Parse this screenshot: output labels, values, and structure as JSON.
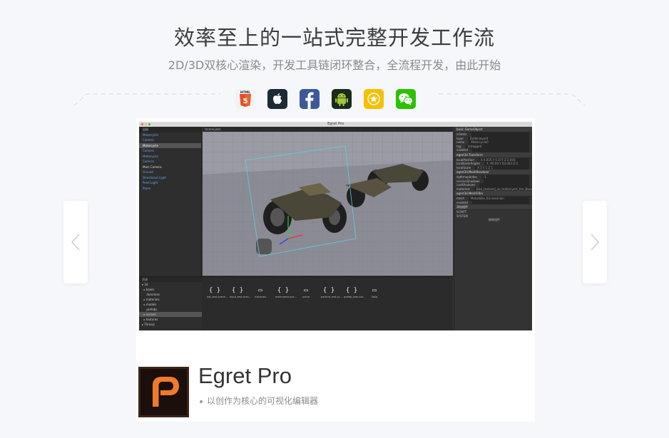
{
  "header": {
    "title": "效率至上的一站式完整开发工作流",
    "subtitle": "2D/3D双核心渲染，开发工具链闭环整合，全流程开发，由此开始"
  },
  "platforms": [
    {
      "icon": "html5-icon",
      "color": "#e34f26",
      "label": "HTML"
    },
    {
      "icon": "apple-icon",
      "color": "#1b2a34"
    },
    {
      "icon": "facebook-icon",
      "color": "#3b5998"
    },
    {
      "icon": "android-icon",
      "color": "#1b2a1b"
    },
    {
      "icon": "star-icon",
      "color": "#f5c000"
    },
    {
      "icon": "wechat-icon",
      "color": "#2dc100"
    }
  ],
  "editor": {
    "window_title": "Egret Pro",
    "tab": "/scene.json",
    "hierarchy_header": "层级",
    "hierarchy": [
      {
        "label": "Motorcycle",
        "style": "link"
      },
      {
        "label": "Camera",
        "style": "link"
      },
      {
        "label": "Motorcycle",
        "style": "selected"
      },
      {
        "label": "Camera",
        "style": "link"
      },
      {
        "label": "Motorcycle",
        "style": "link"
      },
      {
        "label": "Camera",
        "style": "link"
      },
      {
        "label": "Main Camera",
        "style": "white"
      },
      {
        "label": "Ground",
        "style": "link"
      },
      {
        "label": "Directional Light",
        "style": "link"
      },
      {
        "label": "Point Light",
        "style": "link"
      },
      {
        "label": "Plane",
        "style": "link"
      }
    ],
    "inspector": {
      "sections": [
        "basic GameObject",
        "egret3d.Transform",
        "egret3d.MeshRenderer",
        "egret3d.MeshFilter"
      ],
      "basic": [
        {
          "k": "isStatic",
          "v": ""
        },
        {
          "k": "layer",
          "v": "Builtinlayer0"
        },
        {
          "k": "name",
          "v": "Motorcycle0"
        },
        {
          "k": "tag",
          "v": "Untagged"
        },
        {
          "k": "enabled",
          "v": ""
        }
      ],
      "transform": [
        {
          "k": "localPosition",
          "v": "X 0.035  Y 0.377  Z 2.003"
        },
        {
          "k": "localEulerAngles",
          "v": "X -90.00  Y 63.003  Z 0"
        },
        {
          "k": "localScale",
          "v": "X 1  Y 1  Z 1"
        }
      ],
      "renderer": [
        {
          "k": "lightmapIndex",
          "v": "-1"
        },
        {
          "k": "receiveShadows",
          "v": ""
        },
        {
          "k": "castShadows",
          "v": ""
        },
        {
          "k": "materials",
          "v": "bike_texture/j_se_motorcycle_tire_BaseColor.mat"
        }
      ],
      "filter": [
        {
          "k": "mesh",
          "v": "Motorbike_03.mesh.bin"
        },
        {
          "k": "enabled",
          "v": ""
        }
      ],
      "add_component": "添加组件",
      "script": "SCRIPT",
      "system": "SYSTEM",
      "remove": "移除组件"
    },
    "project_header": "资源",
    "project": [
      {
        "label": "▾ 3d",
        "sel": false
      },
      {
        "label": "  ▸ bowls",
        "sel": false
      },
      {
        "label": "     dummies",
        "sel": false
      },
      {
        "label": "  ▸ materials",
        "sel": false
      },
      {
        "label": "  ▸ models",
        "sel": false
      },
      {
        "label": "     prefabs",
        "sel": false
      },
      {
        "label": "  ▸ scenes",
        "sel": true
      },
      {
        "label": "  ▸ textures",
        "sel": false
      },
      {
        "label": "▸ Threejs",
        "sel": false
      }
    ],
    "assets": [
      {
        "icon": "{ }",
        "name": "dot_test.scene..."
      },
      {
        "icon": "{ }",
        "name": "input_test.scen..."
      },
      {
        "icon": "▭",
        "name": "materials"
      },
      {
        "icon": "{ }",
        "name": "meshname.sce..."
      },
      {
        "icon": "▭",
        "name": "scene"
      },
      {
        "icon": "{ }",
        "name": "particle_test.sc..."
      },
      {
        "icon": "{ }",
        "name": "prefab_test.sce..."
      },
      {
        "icon": "▭",
        "name": "Vaila"
      }
    ]
  },
  "product": {
    "name": "Egret Pro",
    "description": "以创作为核心的可视化编辑器"
  }
}
